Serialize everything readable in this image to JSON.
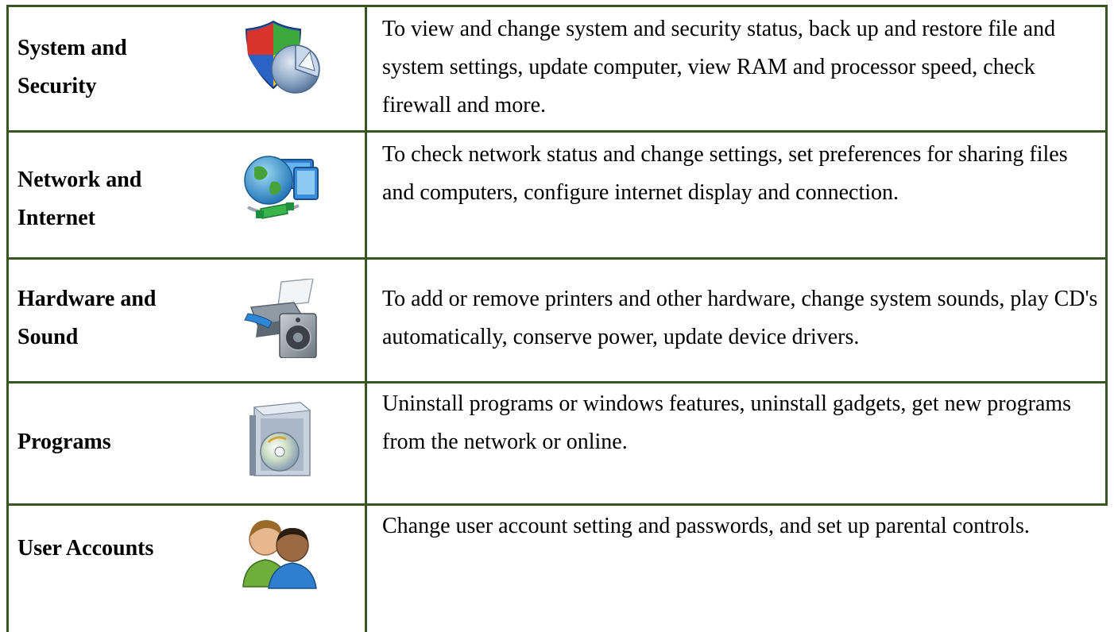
{
  "rows": [
    {
      "label_line1": "System and",
      "label_line2": "Security",
      "icon": "shield-pie-chart-icon",
      "description": "To view and change system and security status, back up and restore file and system settings, update computer, view RAM and processor speed, check firewall and more."
    },
    {
      "label_line1": "Network and",
      "label_line2": "Internet",
      "icon": "globe-network-icon",
      "description": "To check network status and change settings, set preferences for sharing files and computers, configure internet display and connection."
    },
    {
      "label_line1": "Hardware and",
      "label_line2": "Sound",
      "icon": "printer-speaker-icon",
      "description": "To add or remove printers and other hardware, change system sounds, play CD's automatically, conserve power, update device drivers."
    },
    {
      "label_line1": "Programs",
      "icon": "software-box-disc-icon",
      "description": "Uninstall programs or windows features, uninstall gadgets, get new programs from the network or online."
    },
    {
      "label_line1": "User Accounts",
      "icon": "users-icon",
      "description": "Change user account setting and passwords, and set up parental controls."
    }
  ],
  "colors": {
    "border": "#375622"
  }
}
